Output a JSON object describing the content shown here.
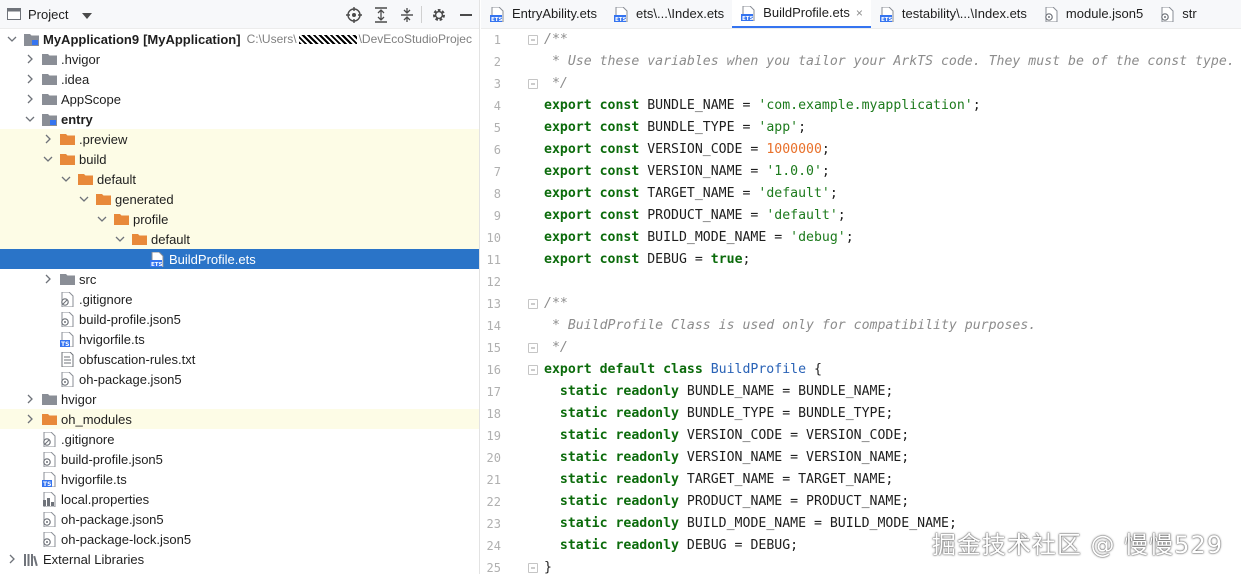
{
  "project_panel": {
    "title": "Project",
    "toolbar_icons": [
      "target-icon",
      "expand-all-icon",
      "collapse-all-icon",
      "gear-icon",
      "minimize-icon"
    ]
  },
  "tree": [
    {
      "depth": 0,
      "arrow": "down",
      "icon": "module",
      "label": "MyApplication9",
      "extra": "[MyApplication]",
      "path_a": "C:\\Users\\",
      "path_b": "\\DevEcoStudioProjec",
      "bold": true
    },
    {
      "depth": 1,
      "arrow": "right",
      "icon": "folder-gray",
      "label": ".hvigor"
    },
    {
      "depth": 1,
      "arrow": "right",
      "icon": "folder-gray",
      "label": ".idea"
    },
    {
      "depth": 1,
      "arrow": "right",
      "icon": "folder-gray",
      "label": "AppScope"
    },
    {
      "depth": 1,
      "arrow": "down",
      "icon": "module",
      "label": "entry",
      "bold": true
    },
    {
      "depth": 2,
      "arrow": "right",
      "icon": "folder-orange",
      "label": ".preview",
      "hl": true
    },
    {
      "depth": 2,
      "arrow": "down",
      "icon": "folder-orange",
      "label": "build",
      "hl": true
    },
    {
      "depth": 3,
      "arrow": "down",
      "icon": "folder-orange",
      "label": "default",
      "hl": true
    },
    {
      "depth": 4,
      "arrow": "down",
      "icon": "folder-orange",
      "label": "generated",
      "hl": true
    },
    {
      "depth": 5,
      "arrow": "down",
      "icon": "folder-orange",
      "label": "profile",
      "hl": true
    },
    {
      "depth": 6,
      "arrow": "down",
      "icon": "folder-orange",
      "label": "default",
      "hl": true
    },
    {
      "depth": 7,
      "arrow": "none",
      "icon": "ets-file",
      "label": "BuildProfile.ets",
      "sel": true
    },
    {
      "depth": 2,
      "arrow": "right",
      "icon": "folder-gray",
      "label": "src"
    },
    {
      "depth": 2,
      "arrow": "none",
      "icon": "gitignore-file",
      "label": ".gitignore"
    },
    {
      "depth": 2,
      "arrow": "none",
      "icon": "json-file",
      "label": "build-profile.json5"
    },
    {
      "depth": 2,
      "arrow": "none",
      "icon": "ts-file",
      "label": "hvigorfile.ts"
    },
    {
      "depth": 2,
      "arrow": "none",
      "icon": "text-file",
      "label": "obfuscation-rules.txt"
    },
    {
      "depth": 2,
      "arrow": "none",
      "icon": "json-file",
      "label": "oh-package.json5"
    },
    {
      "depth": 1,
      "arrow": "right",
      "icon": "folder-gray",
      "label": "hvigor"
    },
    {
      "depth": 1,
      "arrow": "right",
      "icon": "folder-orange",
      "label": "oh_modules",
      "hl": true
    },
    {
      "depth": 1,
      "arrow": "none",
      "icon": "gitignore-file",
      "label": ".gitignore"
    },
    {
      "depth": 1,
      "arrow": "none",
      "icon": "json-file",
      "label": "build-profile.json5"
    },
    {
      "depth": 1,
      "arrow": "none",
      "icon": "ts-file",
      "label": "hvigorfile.ts"
    },
    {
      "depth": 1,
      "arrow": "none",
      "icon": "properties-file",
      "label": "local.properties"
    },
    {
      "depth": 1,
      "arrow": "none",
      "icon": "json-file",
      "label": "oh-package.json5"
    },
    {
      "depth": 1,
      "arrow": "none",
      "icon": "json-file",
      "label": "oh-package-lock.json5"
    },
    {
      "depth": 0,
      "arrow": "right",
      "icon": "libraries",
      "label": "External Libraries"
    }
  ],
  "tabs": [
    {
      "label": "EntryAbility.ets",
      "icon": "ets-file",
      "active": false
    },
    {
      "label": "ets\\...\\Index.ets",
      "icon": "ets-file",
      "active": false
    },
    {
      "label": "BuildProfile.ets",
      "icon": "ets-file",
      "active": true,
      "close": "×"
    },
    {
      "label": "testability\\...\\Index.ets",
      "icon": "ets-file",
      "active": false
    },
    {
      "label": "module.json5",
      "icon": "json-file",
      "active": false
    },
    {
      "label": "str",
      "icon": "json-file",
      "active": false
    }
  ],
  "code": {
    "first_line": 1,
    "lines": [
      [
        [
          "cmt",
          "/**"
        ]
      ],
      [
        [
          "cmt",
          " * Use these variables when you tailor your ArkTS code. They must be of the const type."
        ]
      ],
      [
        [
          "cmt",
          " */"
        ]
      ],
      [
        [
          "kw",
          "export const "
        ],
        [
          "id",
          "BUNDLE_NAME = "
        ],
        [
          "str",
          "'com.example.myapplication'"
        ],
        [
          "punc",
          ";"
        ]
      ],
      [
        [
          "kw",
          "export const "
        ],
        [
          "id",
          "BUNDLE_TYPE = "
        ],
        [
          "str",
          "'app'"
        ],
        [
          "punc",
          ";"
        ]
      ],
      [
        [
          "kw",
          "export const "
        ],
        [
          "id",
          "VERSION_CODE = "
        ],
        [
          "num",
          "1000000"
        ],
        [
          "punc",
          ";"
        ]
      ],
      [
        [
          "kw",
          "export const "
        ],
        [
          "id",
          "VERSION_NAME = "
        ],
        [
          "str",
          "'1.0.0'"
        ],
        [
          "punc",
          ";"
        ]
      ],
      [
        [
          "kw",
          "export const "
        ],
        [
          "id",
          "TARGET_NAME = "
        ],
        [
          "str",
          "'default'"
        ],
        [
          "punc",
          ";"
        ]
      ],
      [
        [
          "kw",
          "export const "
        ],
        [
          "id",
          "PRODUCT_NAME = "
        ],
        [
          "str",
          "'default'"
        ],
        [
          "punc",
          ";"
        ]
      ],
      [
        [
          "kw",
          "export const "
        ],
        [
          "id",
          "BUILD_MODE_NAME = "
        ],
        [
          "str",
          "'debug'"
        ],
        [
          "punc",
          ";"
        ]
      ],
      [
        [
          "kw",
          "export const "
        ],
        [
          "id",
          "DEBUG = "
        ],
        [
          "kw",
          "true"
        ],
        [
          "punc",
          ";"
        ]
      ],
      [],
      [
        [
          "cmt",
          "/**"
        ]
      ],
      [
        [
          "cmt",
          " * BuildProfile Class is used only for compatibility purposes."
        ]
      ],
      [
        [
          "cmt",
          " */"
        ]
      ],
      [
        [
          "kw",
          "export default class "
        ],
        [
          "cls",
          "BuildProfile"
        ],
        [
          "punc",
          " {"
        ]
      ],
      [
        [
          "kw",
          "  static readonly "
        ],
        [
          "id",
          "BUNDLE_NAME = BUNDLE_NAME"
        ],
        [
          "punc",
          ";"
        ]
      ],
      [
        [
          "kw",
          "  static readonly "
        ],
        [
          "id",
          "BUNDLE_TYPE = BUNDLE_TYPE"
        ],
        [
          "punc",
          ";"
        ]
      ],
      [
        [
          "kw",
          "  static readonly "
        ],
        [
          "id",
          "VERSION_CODE = VERSION_CODE"
        ],
        [
          "punc",
          ";"
        ]
      ],
      [
        [
          "kw",
          "  static readonly "
        ],
        [
          "id",
          "VERSION_NAME = VERSION_NAME"
        ],
        [
          "punc",
          ";"
        ]
      ],
      [
        [
          "kw",
          "  static readonly "
        ],
        [
          "id",
          "TARGET_NAME = TARGET_NAME"
        ],
        [
          "punc",
          ";"
        ]
      ],
      [
        [
          "kw",
          "  static readonly "
        ],
        [
          "id",
          "PRODUCT_NAME = PRODUCT_NAME"
        ],
        [
          "punc",
          ";"
        ]
      ],
      [
        [
          "kw",
          "  static readonly "
        ],
        [
          "id",
          "BUILD_MODE_NAME = BUILD_MODE_NAME"
        ],
        [
          "punc",
          ";"
        ]
      ],
      [
        [
          "kw",
          "  static readonly "
        ],
        [
          "id",
          "DEBUG = DEBUG"
        ],
        [
          "punc",
          ";"
        ]
      ],
      [
        [
          "punc",
          "}"
        ]
      ]
    ]
  },
  "watermark": "掘金技术社区 @ 慢慢529",
  "colors": {
    "keyword": "#0b6b0b",
    "string": "#1c7a1c",
    "number": "#e8702a",
    "comment": "#8c8c8c",
    "class": "#2962b6",
    "selection": "#2a74c8",
    "highlight": "#fdfce6"
  }
}
